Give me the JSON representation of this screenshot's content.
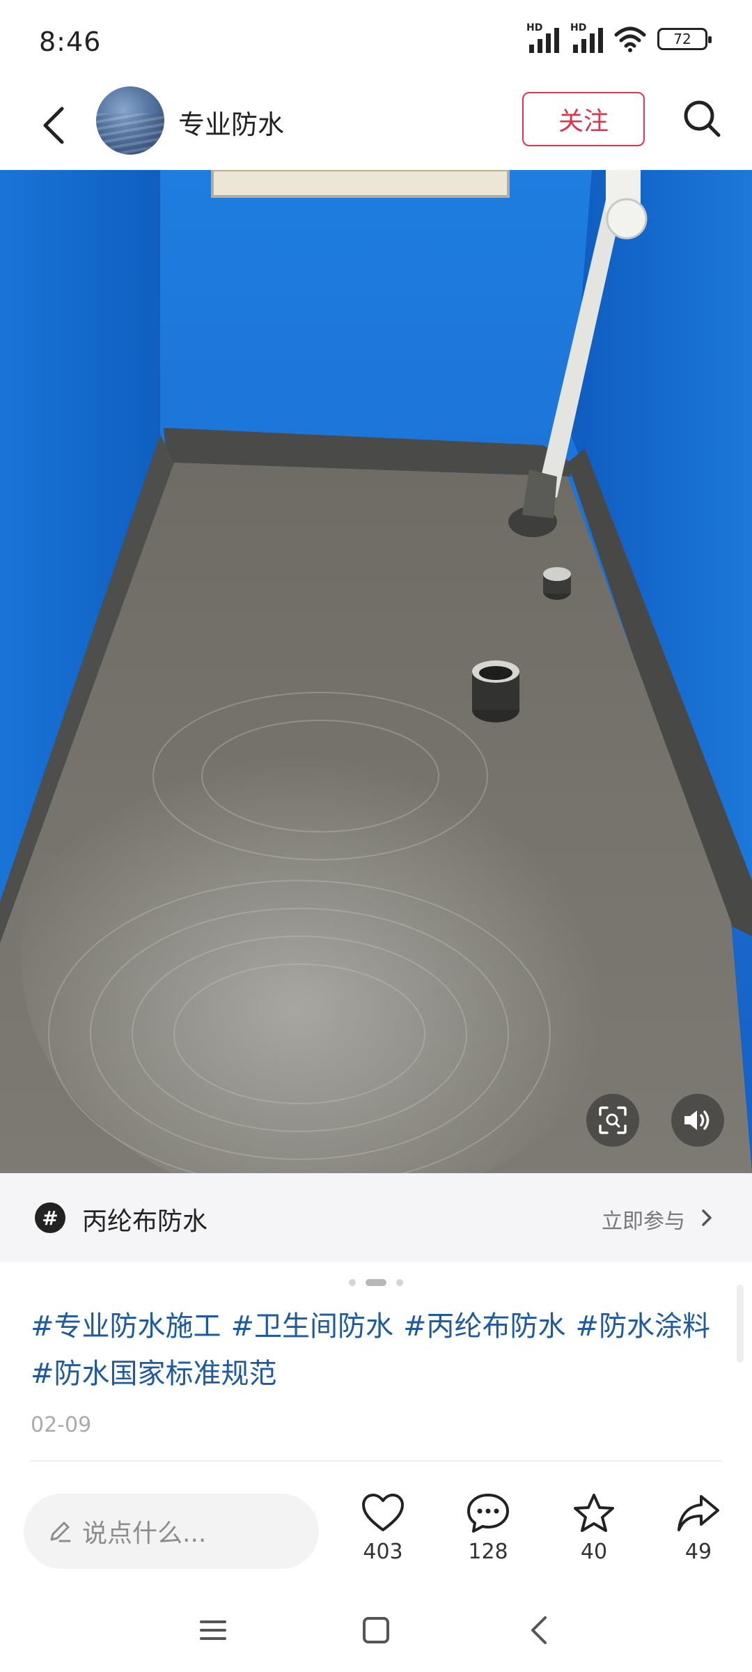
{
  "status_bar": {
    "time": "8:46",
    "signal_1_label": "HD",
    "signal_2_label": "HD",
    "battery": "72"
  },
  "header": {
    "author_name": "专业防水",
    "follow_label": "关注"
  },
  "topic": {
    "name": "丙纶布防水",
    "join_label": "立即参与",
    "icon_glyph": "#"
  },
  "carousel": {
    "current_page": 2,
    "total_pages": 3
  },
  "post": {
    "tags": [
      "#专业防水施工",
      "#卫生间防水",
      "#丙纶布防水",
      "#防水涂料",
      "#防水国家标准规范"
    ],
    "date": "02-09"
  },
  "action_bar": {
    "comment_placeholder": "说点什么...",
    "like_count": "403",
    "comment_count": "128",
    "favorite_count": "40",
    "share_count": "49"
  },
  "colors": {
    "accent": "#e0334d",
    "tag_blue": "#1f5a9c"
  }
}
